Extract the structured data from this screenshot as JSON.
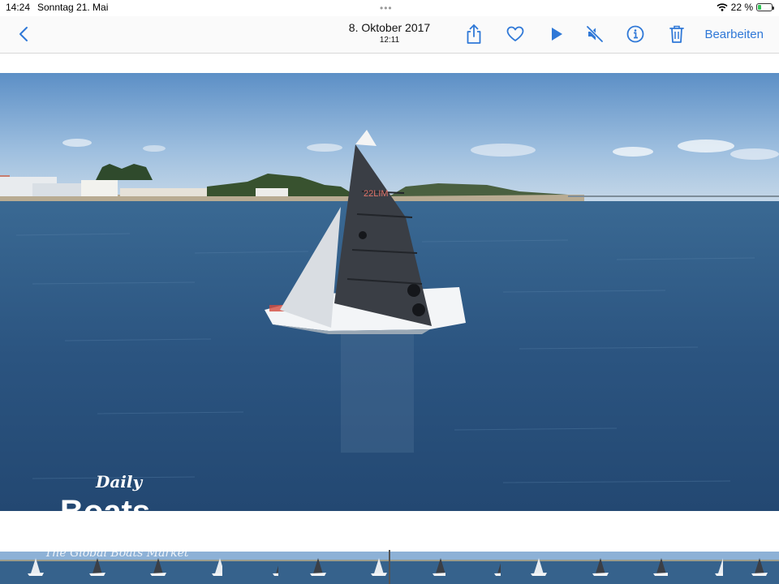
{
  "status_bar": {
    "time": "14:24",
    "date": "Sonntag 21. Mai",
    "battery_percent": "22 %",
    "battery_level": 0.22
  },
  "nav": {
    "date_title": "8. Oktober 2017",
    "time_subtitle": "12:11",
    "edit_label": "Bearbeiten"
  },
  "icons": [
    "chevron-left-icon",
    "share-icon",
    "heart-icon",
    "play-icon",
    "mute-icon",
    "info-icon",
    "trash-icon",
    "wifi-icon",
    "battery-icon"
  ],
  "colors": {
    "accent": "#2f78d7"
  },
  "photo": {
    "watermark_daily": "Daily",
    "watermark_boats": "Boats",
    "filmstrip_text": "The Global Boats Market"
  },
  "filmstrip": {
    "thumb_count": 14,
    "selected_index": 7
  }
}
